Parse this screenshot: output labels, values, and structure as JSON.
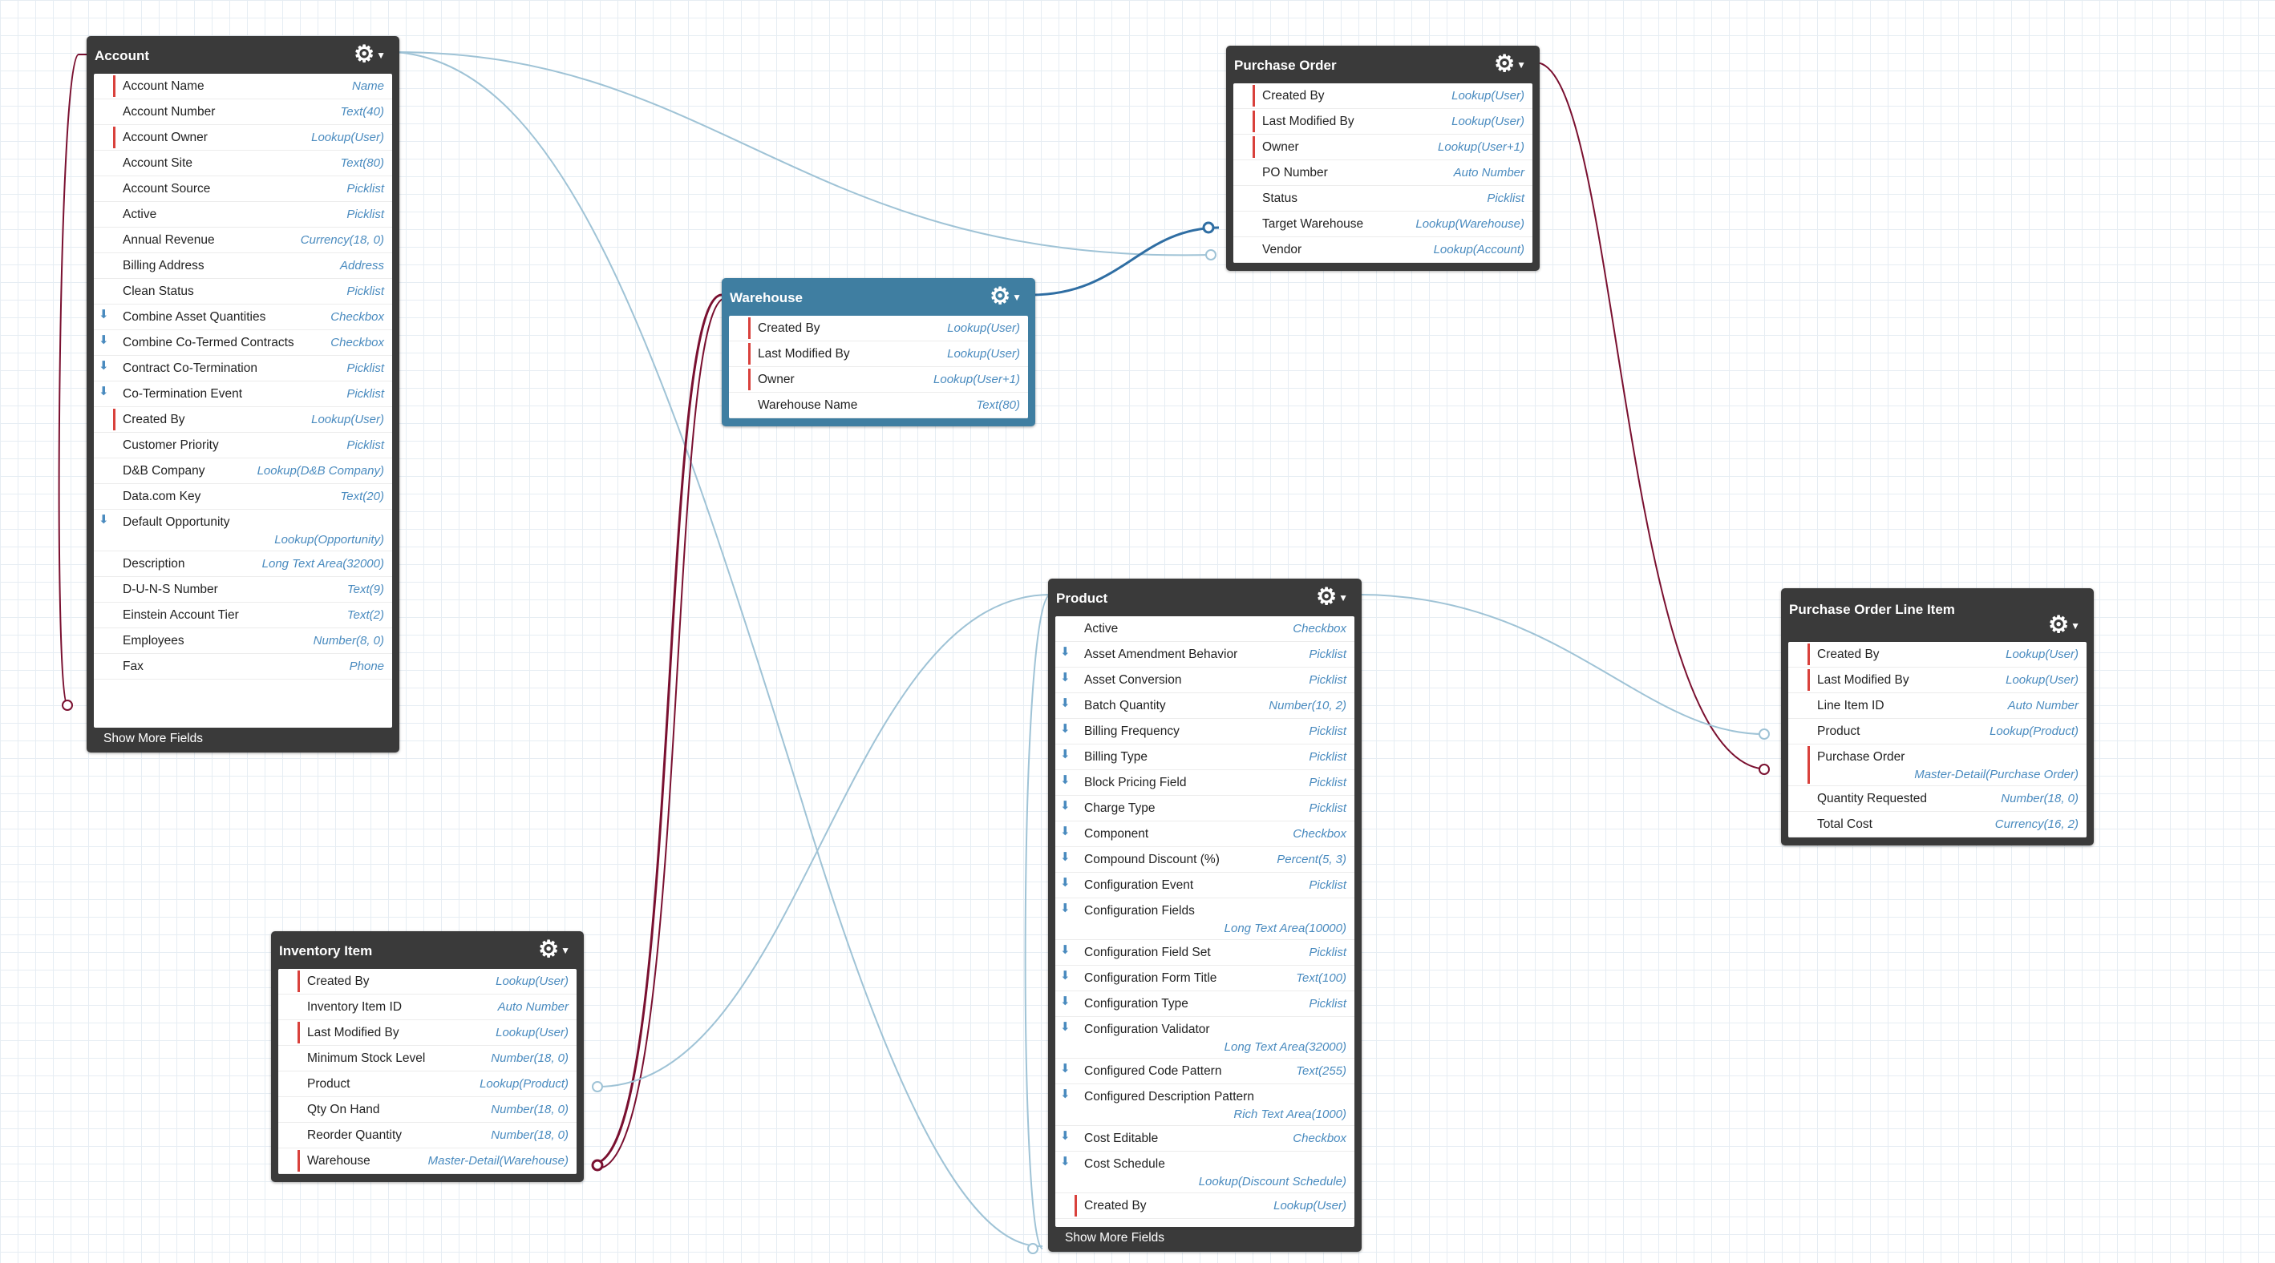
{
  "objects": {
    "account": {
      "title": "Account",
      "more_label": "Show More Fields",
      "fields": [
        {
          "name": "Account Name",
          "type": "Name",
          "req": true
        },
        {
          "name": "Account Number",
          "type": "Text(40)"
        },
        {
          "name": "Account Owner",
          "type": "Lookup(User)",
          "req": true
        },
        {
          "name": "Account Site",
          "type": "Text(80)"
        },
        {
          "name": "Account Source",
          "type": "Picklist"
        },
        {
          "name": "Active",
          "type": "Picklist"
        },
        {
          "name": "Annual Revenue",
          "type": "Currency(18, 0)"
        },
        {
          "name": "Billing Address",
          "type": "Address"
        },
        {
          "name": "Clean Status",
          "type": "Picklist"
        },
        {
          "name": "Combine Asset Quantities",
          "type": "Checkbox",
          "pkg": true
        },
        {
          "name": "Combine Co-Termed Contracts",
          "type": "Checkbox",
          "pkg": true
        },
        {
          "name": "Contract Co-Termination",
          "type": "Picklist",
          "pkg": true
        },
        {
          "name": "Co-Termination Event",
          "type": "Picklist",
          "pkg": true
        },
        {
          "name": "Created By",
          "type": "Lookup(User)",
          "req": true
        },
        {
          "name": "Customer Priority",
          "type": "Picklist"
        },
        {
          "name": "D&B Company",
          "type": "Lookup(D&B Company)"
        },
        {
          "name": "Data.com Key",
          "type": "Text(20)"
        },
        {
          "name": "Default Opportunity",
          "type": "Lookup(Opportunity)",
          "pkg": true,
          "tall": true
        },
        {
          "name": "Description",
          "type": "Long Text Area(32000)"
        },
        {
          "name": "D-U-N-S Number",
          "type": "Text(9)"
        },
        {
          "name": "Einstein Account Tier",
          "type": "Text(2)"
        },
        {
          "name": "Employees",
          "type": "Number(8, 0)"
        },
        {
          "name": "Fax",
          "type": "Phone"
        }
      ]
    },
    "purchase_order": {
      "title": "Purchase Order",
      "fields": [
        {
          "name": "Created By",
          "type": "Lookup(User)",
          "req": true
        },
        {
          "name": "Last Modified By",
          "type": "Lookup(User)",
          "req": true
        },
        {
          "name": "Owner",
          "type": "Lookup(User+1)",
          "req": true
        },
        {
          "name": "PO Number",
          "type": "Auto Number"
        },
        {
          "name": "Status",
          "type": "Picklist"
        },
        {
          "name": "Target Warehouse",
          "type": "Lookup(Warehouse)"
        },
        {
          "name": "Vendor",
          "type": "Lookup(Account)"
        }
      ]
    },
    "warehouse": {
      "title": "Warehouse",
      "fields": [
        {
          "name": "Created By",
          "type": "Lookup(User)",
          "req": true
        },
        {
          "name": "Last Modified By",
          "type": "Lookup(User)",
          "req": true
        },
        {
          "name": "Owner",
          "type": "Lookup(User+1)",
          "req": true
        },
        {
          "name": "Warehouse Name",
          "type": "Text(80)"
        }
      ]
    },
    "product": {
      "title": "Product",
      "more_label": "Show More Fields",
      "fields": [
        {
          "name": "Active",
          "type": "Checkbox"
        },
        {
          "name": "Asset Amendment Behavior",
          "type": "Picklist",
          "pkg": true
        },
        {
          "name": "Asset Conversion",
          "type": "Picklist",
          "pkg": true
        },
        {
          "name": "Batch Quantity",
          "type": "Number(10, 2)",
          "pkg": true
        },
        {
          "name": "Billing Frequency",
          "type": "Picklist",
          "pkg": true
        },
        {
          "name": "Billing Type",
          "type": "Picklist",
          "pkg": true
        },
        {
          "name": "Block Pricing Field",
          "type": "Picklist",
          "pkg": true
        },
        {
          "name": "Charge Type",
          "type": "Picklist",
          "pkg": true
        },
        {
          "name": "Component",
          "type": "Checkbox",
          "pkg": true
        },
        {
          "name": "Compound Discount (%)",
          "type": "Percent(5, 3)",
          "pkg": true
        },
        {
          "name": "Configuration Event",
          "type": "Picklist",
          "pkg": true
        },
        {
          "name": "Configuration Fields",
          "type": "Long Text Area(10000)",
          "pkg": true,
          "tall": true
        },
        {
          "name": "Configuration Field Set",
          "type": "Picklist",
          "pkg": true
        },
        {
          "name": "Configuration Form Title",
          "type": "Text(100)",
          "pkg": true
        },
        {
          "name": "Configuration Type",
          "type": "Picklist",
          "pkg": true
        },
        {
          "name": "Configuration Validator",
          "type": "Long Text Area(32000)",
          "pkg": true,
          "tall": true
        },
        {
          "name": "Configured Code Pattern",
          "type": "Text(255)",
          "pkg": true
        },
        {
          "name": "Configured Description Pattern",
          "type": "Rich Text Area(1000)",
          "pkg": true,
          "tall": true
        },
        {
          "name": "Cost Editable",
          "type": "Checkbox",
          "pkg": true
        },
        {
          "name": "Cost Schedule",
          "type": "Lookup(Discount Schedule)",
          "pkg": true,
          "tall": true
        },
        {
          "name": "Created By",
          "type": "Lookup(User)",
          "req": true
        }
      ]
    },
    "poli": {
      "title": "Purchase Order Line Item",
      "fields": [
        {
          "name": "Created By",
          "type": "Lookup(User)",
          "req": true
        },
        {
          "name": "Last Modified By",
          "type": "Lookup(User)",
          "req": true
        },
        {
          "name": "Line Item ID",
          "type": "Auto Number"
        },
        {
          "name": "Product",
          "type": "Lookup(Product)"
        },
        {
          "name": "Purchase Order",
          "type": "Master-Detail(Purchase Order)",
          "req": true,
          "tall": true
        },
        {
          "name": "Quantity Requested",
          "type": "Number(18, 0)"
        },
        {
          "name": "Total Cost",
          "type": "Currency(16, 2)"
        }
      ]
    },
    "inventory": {
      "title": "Inventory Item",
      "fields": [
        {
          "name": "Created By",
          "type": "Lookup(User)",
          "req": true
        },
        {
          "name": "Inventory Item ID",
          "type": "Auto Number"
        },
        {
          "name": "Last Modified By",
          "type": "Lookup(User)",
          "req": true
        },
        {
          "name": "Minimum Stock Level",
          "type": "Number(18, 0)"
        },
        {
          "name": "Product",
          "type": "Lookup(Product)"
        },
        {
          "name": "Qty On Hand",
          "type": "Number(18, 0)"
        },
        {
          "name": "Reorder Quantity",
          "type": "Number(18, 0)"
        },
        {
          "name": "Warehouse",
          "type": "Master-Detail(Warehouse)",
          "req": true
        }
      ]
    }
  },
  "colors": {
    "header": "#3a3a3a",
    "selected_header": "#3f7ea1",
    "lookup_line": "#9fc3d6",
    "lookup_line_selected": "#2f6ea3",
    "master_detail_line": "#7a1030",
    "required_marker": "#d9413c",
    "type_text": "#4a8bbf"
  }
}
